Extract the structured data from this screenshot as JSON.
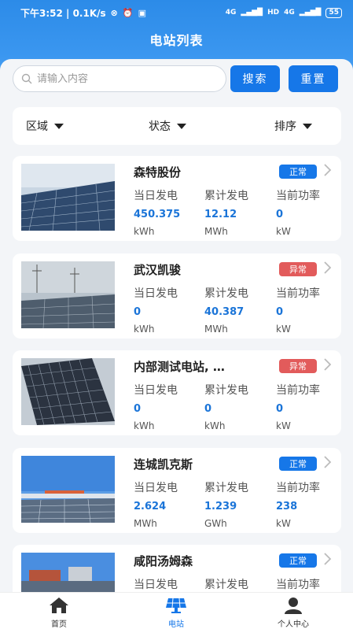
{
  "status_bar": {
    "time": "下午3:52 | 0.1K/s",
    "signal1": "4G",
    "hd": "HD",
    "signal2": "4G",
    "battery": "55"
  },
  "header": {
    "title": "电站列表"
  },
  "search": {
    "placeholder": "请输入内容",
    "search_label": "搜索",
    "reset_label": "重置"
  },
  "filters": [
    {
      "label": "区域"
    },
    {
      "label": "状态"
    },
    {
      "label": "排序"
    }
  ],
  "metric_labels": {
    "daily": "当日发电",
    "total": "累计发电",
    "power": "当前功率"
  },
  "stations": [
    {
      "name": "森特股份",
      "status": "正常",
      "status_type": "normal",
      "daily": "450.375",
      "daily_unit": "kWh",
      "total": "12.12",
      "total_unit": "MWh",
      "power": "0",
      "power_unit": "kW"
    },
    {
      "name": "武汉凯骏",
      "status": "异常",
      "status_type": "abnormal",
      "daily": "0",
      "daily_unit": "kWh",
      "total": "40.387",
      "total_unit": "MWh",
      "power": "0",
      "power_unit": "kW"
    },
    {
      "name": "内部测试电站, …",
      "status": "异常",
      "status_type": "abnormal",
      "daily": "0",
      "daily_unit": "kWh",
      "total": "0",
      "total_unit": "kWh",
      "power": "0",
      "power_unit": "kW"
    },
    {
      "name": "连城凯克斯",
      "status": "正常",
      "status_type": "normal",
      "daily": "2.624",
      "daily_unit": "MWh",
      "total": "1.239",
      "total_unit": "GWh",
      "power": "238",
      "power_unit": "kW"
    },
    {
      "name": "咸阳汤姆森",
      "status": "正常",
      "status_type": "normal",
      "daily": "",
      "daily_unit": "",
      "total": "",
      "total_unit": "",
      "power": "",
      "power_unit": ""
    }
  ],
  "tabbar": [
    {
      "label": "首页",
      "icon": "home-icon"
    },
    {
      "label": "电站",
      "icon": "solar-panel-icon"
    },
    {
      "label": "个人中心",
      "icon": "user-icon"
    }
  ],
  "colors": {
    "primary": "#1677e8",
    "abnormal": "#e25b5b",
    "value": "#1a74d8"
  }
}
